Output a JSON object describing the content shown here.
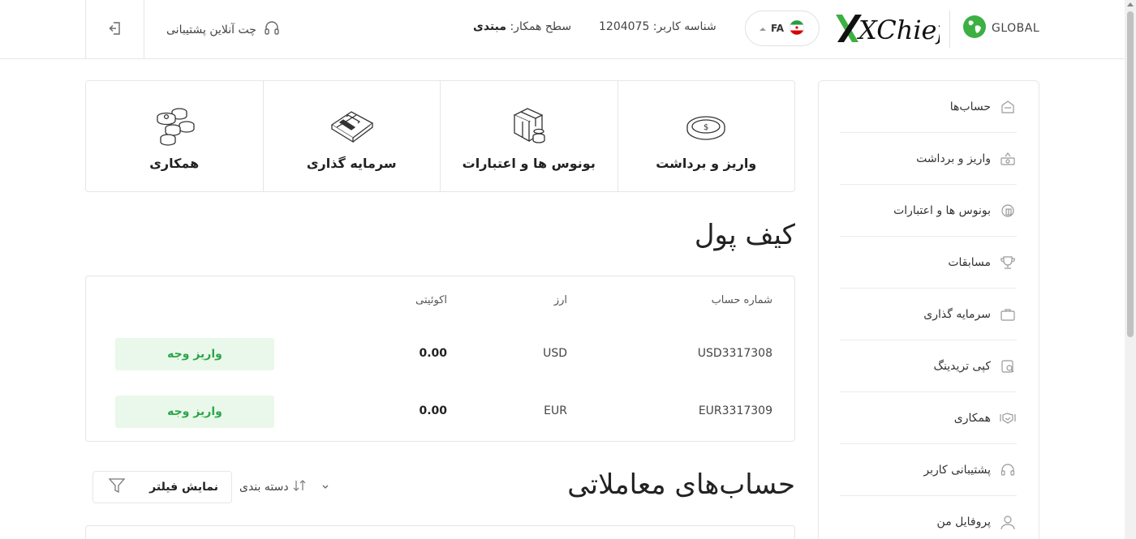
{
  "header": {
    "global_label": "GLOBAL",
    "logo_text": "XChief",
    "lang": "FA",
    "user_id_text": "شناسه کاربر: 1204075",
    "partner_level_label": "سطح همکار:",
    "partner_level_value": "مبتدی",
    "support_chat": "چت آنلاین پشتیبانی"
  },
  "sidebar": {
    "items": [
      {
        "label": "حساب‌ها",
        "icon": "accounts-icon"
      },
      {
        "label": "واریز و برداشت",
        "icon": "deposit-withdraw-icon"
      },
      {
        "label": "بونوس ها و اعتبارات",
        "icon": "bonus-icon"
      },
      {
        "label": "مسابقات",
        "icon": "trophy-icon"
      },
      {
        "label": "سرمایه گذاری",
        "icon": "briefcase-icon"
      },
      {
        "label": "کپی تریدینگ",
        "icon": "copy-trading-icon"
      },
      {
        "label": "همکاری",
        "icon": "handshake-icon"
      },
      {
        "label": "پشتیبانی کاربر",
        "icon": "headset-icon"
      },
      {
        "label": "پروفایل من",
        "icon": "user-icon"
      }
    ]
  },
  "cards": [
    {
      "label": "همکاری",
      "icon": "coins-stack-icon"
    },
    {
      "label": "سرمایه گذاری",
      "icon": "briefcase-icon"
    },
    {
      "label": "بونوس ها و اعتبارات",
      "icon": "gift-box-icon"
    },
    {
      "label": "واریز و برداشت",
      "icon": "coin-icon"
    }
  ],
  "wallet": {
    "title": "کیف پول",
    "columns": {
      "account": "شماره حساب",
      "currency": "ارز",
      "equity": "اکوئیتی"
    },
    "rows": [
      {
        "account": "USD3317308",
        "currency": "USD",
        "equity": "0.00",
        "action": "واریز وجه"
      },
      {
        "account": "EUR3317309",
        "currency": "EUR",
        "equity": "0.00",
        "action": "واریز وجه"
      }
    ]
  },
  "trading": {
    "title": "حساب‌های معاملاتی",
    "sort_label": "دسته بندی",
    "filter_label": "نمایش فیلتر"
  }
}
